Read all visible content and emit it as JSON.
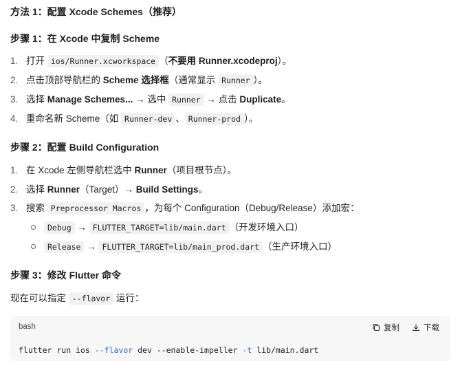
{
  "heading_method": "方法 1：配置 Xcode Schemes（推荐）",
  "step1": {
    "title": "步骤 1：在 Xcode 中复制 Scheme",
    "items": [
      {
        "n": "1.",
        "a": "打开 ",
        "code": "ios/Runner.xcworkspace",
        "b_pre": "（",
        "bold": "不要用 Runner.xcodeproj",
        "b_post": "）。"
      },
      {
        "n": "2.",
        "a": "点击顶部导航栏的 ",
        "bold": "Scheme 选择框",
        "b": "（通常显示 ",
        "code": "Runner",
        "c": "）。"
      },
      {
        "n": "3.",
        "a": "选择 ",
        "bold": "Manage Schemes...",
        "b": " → 选中 ",
        "code": "Runner",
        "c": " → 点击 ",
        "bold2": "Duplicate",
        "d": "。"
      },
      {
        "n": "4.",
        "a": "重命名新 Scheme（如 ",
        "code": "Runner-dev",
        "b": "、",
        "code2": "Runner-prod",
        "c": "）。"
      }
    ]
  },
  "step2": {
    "title": "步骤 2：配置 Build Configuration",
    "items": [
      {
        "n": "1.",
        "a": "在 Xcode 左侧导航栏选中 ",
        "bold": "Runner",
        "b": "（项目根节点）。"
      },
      {
        "n": "2.",
        "a": "选择 ",
        "bold": "Runner",
        "b": "（Target）→ ",
        "bold2": "Build Settings",
        "c": "。"
      },
      {
        "n": "3.",
        "a": "搜索 ",
        "code": "Preprocessor Macros",
        "b": "，为每个 Configuration（Debug/Release）添加宏："
      }
    ],
    "subitems": [
      {
        "code": "Debug",
        "arrow": " → ",
        "code2": "FLUTTER_TARGET=lib/main.dart",
        "note": "（开发环境入口）"
      },
      {
        "code": "Release",
        "arrow": " → ",
        "code2": "FLUTTER_TARGET=lib/main_prod.dart",
        "note": "（生产环境入口）"
      }
    ]
  },
  "step3": {
    "title": "步骤 3：修改 Flutter 命令",
    "intro_a": "现在可以指定 ",
    "intro_code": "--flavor",
    "intro_b": " 运行："
  },
  "codeblock": {
    "lang": "bash",
    "copy_label": "复制",
    "download_label": "下载",
    "code_parts": [
      "flutter run ios ",
      "--flavor",
      " dev --enable-impeller ",
      "-t",
      " lib/main.dart"
    ]
  }
}
